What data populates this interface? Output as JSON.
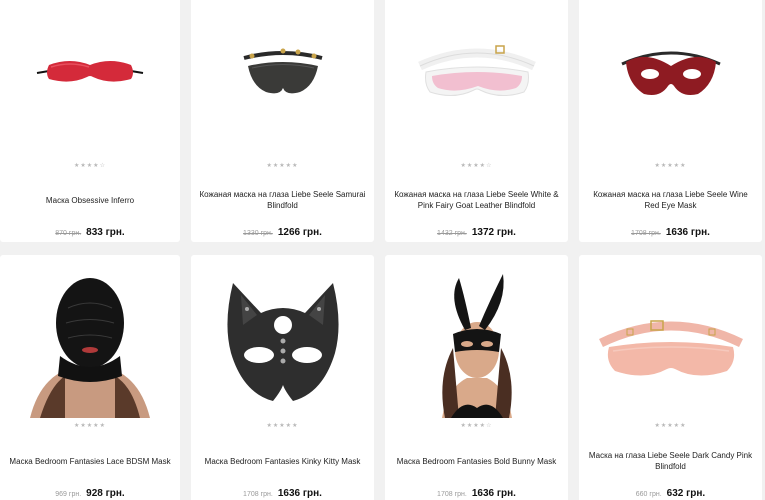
{
  "products": [
    {
      "title": "Маска Obsessive Inferro",
      "rating": "★★★★☆",
      "old_price": "870 грн.",
      "price": "833 грн.",
      "icon": "red-blindfold-image"
    },
    {
      "title": "Кожаная маска на глаза Liebe Seele Samurai Blindfold",
      "rating": "★★★★★",
      "old_price": "1330 грн.",
      "price": "1266 грн.",
      "icon": "black-leather-blindfold-image"
    },
    {
      "title": "Кожаная маска на глаза Liebe Seele White & Pink Fairy Goat Leather Blindfold",
      "rating": "★★★★☆",
      "old_price": "1432 грн.",
      "price": "1372 грн.",
      "icon": "pink-white-blindfold-image"
    },
    {
      "title": "Кожаная маска на глаза Liebe Seele Wine Red Eye Mask",
      "rating": "★★★★★",
      "old_price": "1708 грн.",
      "price": "1636 грн.",
      "icon": "wine-red-eye-mask-image"
    },
    {
      "title": "Маска Bedroom Fantasies Lace BDSM Mask",
      "rating": "★★★★★",
      "old_price": "969 грн.",
      "price": "928 грн.",
      "icon": "lace-hood-photo"
    },
    {
      "title": "Маска Bedroom Fantasies Kinky Kitty Mask",
      "rating": "★★★★★",
      "old_price": "1708 грн.",
      "price": "1636 грн.",
      "icon": "kitty-mask-image"
    },
    {
      "title": "Маска Bedroom Fantasies Bold Bunny Mask",
      "rating": "★★★★☆",
      "old_price": "1708 грн.",
      "price": "1636 грн.",
      "icon": "bunny-mask-photo"
    },
    {
      "title": "Маска на глаза Liebe Seele Dark Candy Pink Blindfold",
      "rating": "★★★★★",
      "old_price": "660 грн.",
      "price": "632 грн.",
      "icon": "candy-pink-blindfold-image"
    }
  ],
  "colors": {
    "page_bg": "#f1f1f1",
    "card_bg": "#ffffff",
    "price": "#111111",
    "old_price": "#9a9a9a",
    "star": "#b8b8b8"
  }
}
